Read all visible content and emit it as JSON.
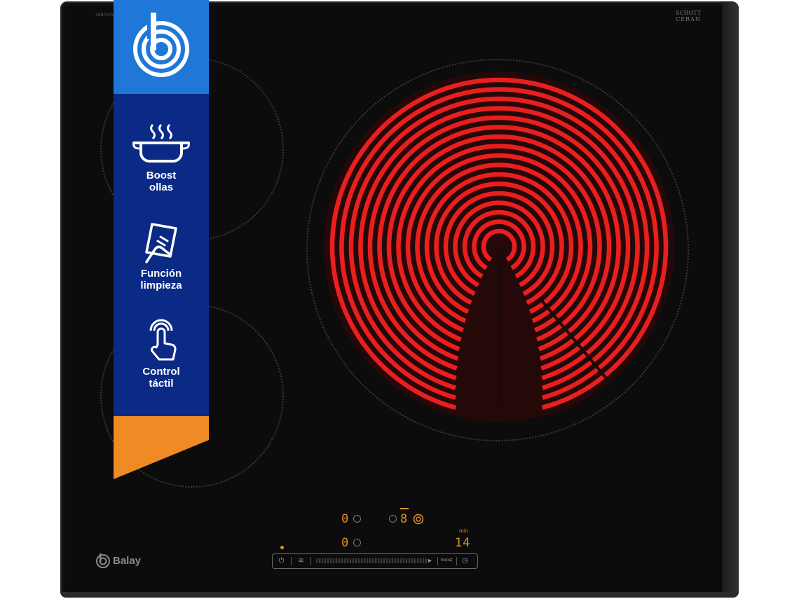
{
  "product": {
    "model_code": "3EB767LQ",
    "glass_brand_line1": "SCHOTT",
    "glass_brand_line2": "CERAN",
    "brand": "Balay"
  },
  "banner": {
    "colors": {
      "logo_bg": "#1f78d8",
      "panel_bg": "#0b2a86",
      "accent": "#f08a24"
    },
    "features": [
      {
        "icon": "pot-steam-icon",
        "line1": "Boost",
        "line2": "ollas"
      },
      {
        "icon": "cleaning-cloth-hand-icon",
        "line1": "Función",
        "line2": "limpieza"
      },
      {
        "icon": "touch-finger-icon",
        "line1": "Control",
        "line2": "táctil"
      }
    ]
  },
  "control_panel": {
    "display_front_left": "0",
    "display_rear_left": "0",
    "display_main": "8",
    "timer_value": "14",
    "timer_unit": "min",
    "boost_label": "boost",
    "slider_prev": "◂",
    "slider_next": "▸"
  },
  "colors": {
    "glass": "#0c0c0c",
    "heating_element": "#ff2222",
    "display": "#e0902a"
  }
}
